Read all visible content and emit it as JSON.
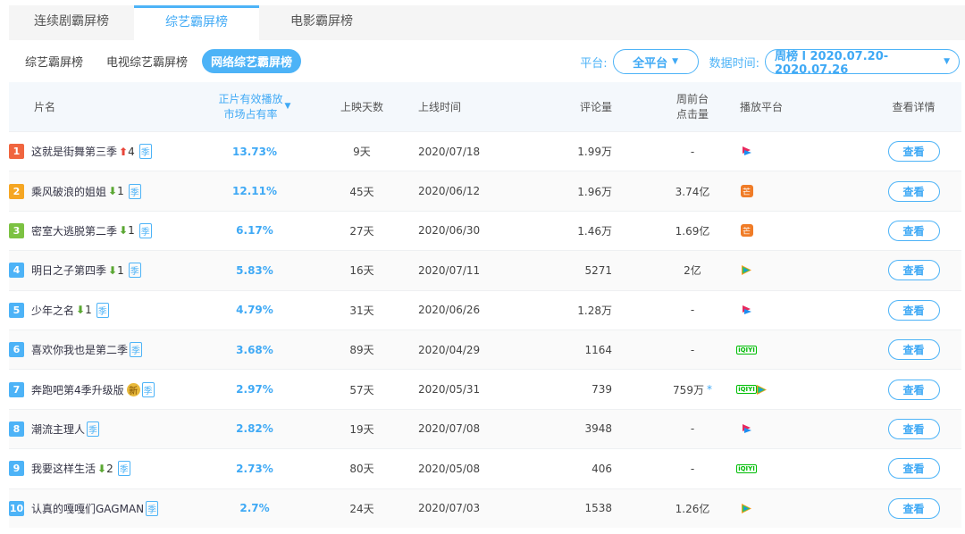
{
  "tabs": [
    "连续剧霸屏榜",
    "综艺霸屏榜",
    "电影霸屏榜"
  ],
  "active_tab": 1,
  "subtabs": [
    "综艺霸屏榜",
    "电视综艺霸屏榜",
    "网络综艺霸屏榜"
  ],
  "active_subtab": 2,
  "filters": {
    "platform_label": "平台:",
    "platform_value": "全平台",
    "time_label": "数据时间:",
    "time_value": "周榜 l 2020.07.20-2020.07.26"
  },
  "headers": {
    "name": "片名",
    "share_line1": "正片有效播放",
    "share_line2": "市场占有率",
    "days": "上映天数",
    "date": "上线时间",
    "comments": "评论量",
    "clicks_line1": "周前台",
    "clicks_line2": "点击量",
    "platform": "播放平台",
    "detail": "查看详情"
  },
  "colors": {
    "accent": "#4db3f7",
    "rank1": "#f0653f",
    "rank2": "#f5a623",
    "rank3": "#7cc242",
    "rank_other": "#4db3f7"
  },
  "season_label": "季",
  "new_label": "新",
  "view_label": "查看",
  "rows": [
    {
      "rank": "1",
      "title": "这就是街舞第三季",
      "trend": "up",
      "change": "4",
      "share": "13.73%",
      "days": "9天",
      "date": "2020/07/18",
      "comments": "1.99万",
      "clicks": "-",
      "platforms": [
        "youku"
      ]
    },
    {
      "rank": "2",
      "title": "乘风破浪的姐姐",
      "trend": "down",
      "change": "1",
      "share": "12.11%",
      "days": "45天",
      "date": "2020/06/12",
      "comments": "1.96万",
      "clicks": "3.74亿",
      "platforms": [
        "mango"
      ]
    },
    {
      "rank": "3",
      "title": "密室大逃脱第二季",
      "trend": "down",
      "change": "1",
      "share": "6.17%",
      "days": "27天",
      "date": "2020/06/30",
      "comments": "1.46万",
      "clicks": "1.69亿",
      "platforms": [
        "mango"
      ]
    },
    {
      "rank": "4",
      "title": "明日之子第四季",
      "trend": "down",
      "change": "1",
      "share": "5.83%",
      "days": "16天",
      "date": "2020/07/11",
      "comments": "5271",
      "clicks": "2亿",
      "platforms": [
        "tencent"
      ]
    },
    {
      "rank": "5",
      "title": "少年之名",
      "trend": "down",
      "change": "1",
      "share": "4.79%",
      "days": "31天",
      "date": "2020/06/26",
      "comments": "1.28万",
      "clicks": "-",
      "platforms": [
        "youku"
      ]
    },
    {
      "rank": "6",
      "title": "喜欢你我也是第二季",
      "trend": "",
      "change": "",
      "share": "3.68%",
      "days": "89天",
      "date": "2020/04/29",
      "comments": "1164",
      "clicks": "-",
      "platforms": [
        "iqiyi"
      ]
    },
    {
      "rank": "7",
      "title": "奔跑吧第4季升级版",
      "trend": "new",
      "change": "",
      "share": "2.97%",
      "days": "57天",
      "date": "2020/05/31",
      "comments": "739",
      "clicks": "759万",
      "clicks_mark": "*",
      "platforms": [
        "iqiyi",
        "tencent"
      ]
    },
    {
      "rank": "8",
      "title": "潮流主理人",
      "trend": "",
      "change": "",
      "share": "2.82%",
      "days": "19天",
      "date": "2020/07/08",
      "comments": "3948",
      "clicks": "-",
      "platforms": [
        "youku"
      ]
    },
    {
      "rank": "9",
      "title": "我要这样生活",
      "trend": "down",
      "change": "2",
      "share": "2.73%",
      "days": "80天",
      "date": "2020/05/08",
      "comments": "406",
      "clicks": "-",
      "platforms": [
        "iqiyi"
      ]
    },
    {
      "rank": "10",
      "title": "认真的嘎嘎们GAGMAN",
      "trend": "",
      "change": "",
      "share": "2.7%",
      "days": "24天",
      "date": "2020/07/03",
      "comments": "1538",
      "clicks": "1.26亿",
      "platforms": [
        "tencent"
      ]
    }
  ]
}
